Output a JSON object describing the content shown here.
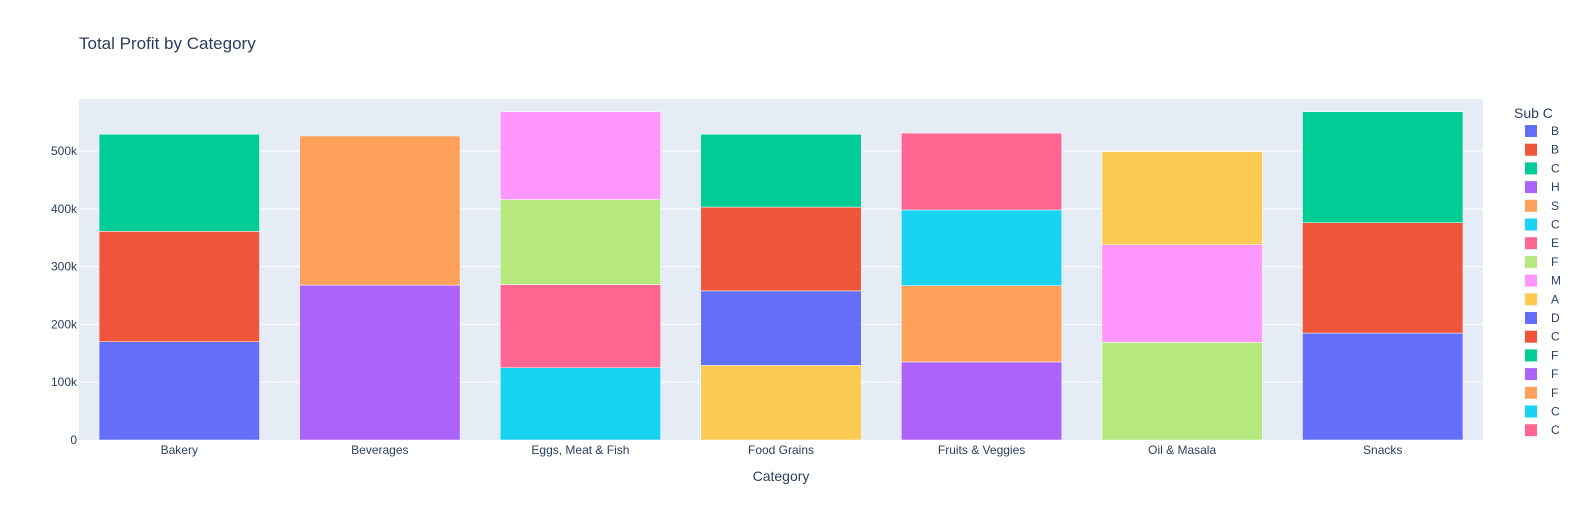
{
  "chart_data": {
    "type": "bar",
    "stacked": true,
    "title": "Total Profit by Category",
    "xlabel": "Category",
    "ylabel": "",
    "ylim": [
      0,
      590000
    ],
    "yticks": [
      0,
      100000,
      200000,
      300000,
      400000,
      500000
    ],
    "ytick_labels": [
      "0",
      "100k",
      "200k",
      "300k",
      "400k",
      "500k"
    ],
    "categories": [
      "Bakery",
      "Beverages",
      "Eggs, Meat & Fish",
      "Food Grains",
      "Fruits & Veggies",
      "Oil & Masala",
      "Snacks"
    ],
    "legend_title": "Sub C",
    "legend_placement": "right",
    "legend_entries": [
      "B",
      "B",
      "C",
      "H",
      "S",
      "C",
      "E",
      "F",
      "M",
      "A",
      "D",
      "C",
      "F",
      "F",
      "F",
      "C",
      "C"
    ],
    "colors": [
      "#636efa",
      "#ef553b",
      "#00cc96",
      "#ab63fa",
      "#ffa15a",
      "#19d3f3",
      "#ff6692",
      "#b6e880",
      "#ff97ff",
      "#fecb52"
    ],
    "background": "#e5ecf6",
    "grid": true,
    "bars": [
      {
        "category": "Bakery",
        "segments": [
          {
            "value": 170000,
            "color": "#636efa"
          },
          {
            "value": 191000,
            "color": "#ef553b"
          },
          {
            "value": 168000,
            "color": "#00cc96"
          }
        ]
      },
      {
        "category": "Beverages",
        "segments": [
          {
            "value": 268000,
            "color": "#ab63fa"
          },
          {
            "value": 258000,
            "color": "#ffa15a"
          }
        ]
      },
      {
        "category": "Eggs, Meat & Fish",
        "segments": [
          {
            "value": 125000,
            "color": "#19d3f3"
          },
          {
            "value": 144000,
            "color": "#ff6692"
          },
          {
            "value": 147000,
            "color": "#b6e880"
          },
          {
            "value": 152000,
            "color": "#ff97ff"
          }
        ]
      },
      {
        "category": "Food Grains",
        "segments": [
          {
            "value": 129000,
            "color": "#fecb52"
          },
          {
            "value": 129000,
            "color": "#636efa"
          },
          {
            "value": 145000,
            "color": "#ef553b"
          },
          {
            "value": 126000,
            "color": "#00cc96"
          }
        ]
      },
      {
        "category": "Fruits & Veggies",
        "segments": [
          {
            "value": 135000,
            "color": "#ab63fa"
          },
          {
            "value": 132000,
            "color": "#ffa15a"
          },
          {
            "value": 131000,
            "color": "#19d3f3"
          },
          {
            "value": 133000,
            "color": "#ff6692"
          }
        ]
      },
      {
        "category": "Oil & Masala",
        "segments": [
          {
            "value": 169000,
            "color": "#b6e880"
          },
          {
            "value": 169000,
            "color": "#ff97ff"
          },
          {
            "value": 161000,
            "color": "#fecb52"
          }
        ]
      },
      {
        "category": "Snacks",
        "segments": [
          {
            "value": 185000,
            "color": "#636efa"
          },
          {
            "value": 191000,
            "color": "#ef553b"
          },
          {
            "value": 192000,
            "color": "#00cc96"
          }
        ]
      }
    ]
  }
}
